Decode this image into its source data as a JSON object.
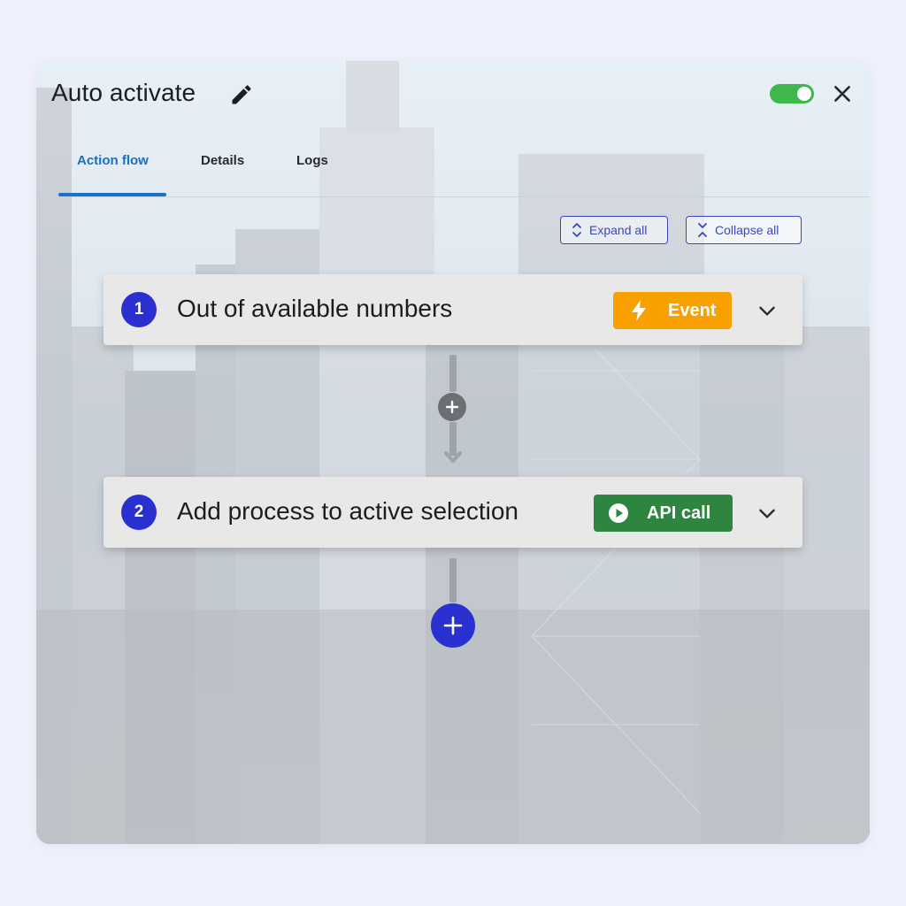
{
  "panel": {
    "title": "Auto activate",
    "enabled": true,
    "icons": {
      "edit": "pencil-icon",
      "close": "close-icon"
    }
  },
  "tabs": [
    {
      "label": "Action flow",
      "active": true
    },
    {
      "label": "Details",
      "active": false
    },
    {
      "label": "Logs",
      "active": false
    }
  ],
  "toolbar": {
    "expand_label": "Expand all",
    "collapse_label": "Collapse all"
  },
  "steps": [
    {
      "number": "1",
      "title": "Out of available numbers",
      "badge": "Event",
      "badge_color": "#f7a000",
      "badge_icon": "lightning-icon"
    },
    {
      "number": "2",
      "title": "Add process to active selection",
      "badge": "API call",
      "badge_color": "#2e8540",
      "badge_icon": "play-circle-icon"
    }
  ],
  "colors": {
    "accent": "#2a2fcf",
    "tab_active": "#1a6fbf",
    "toggle_on": "#3fb84b"
  }
}
